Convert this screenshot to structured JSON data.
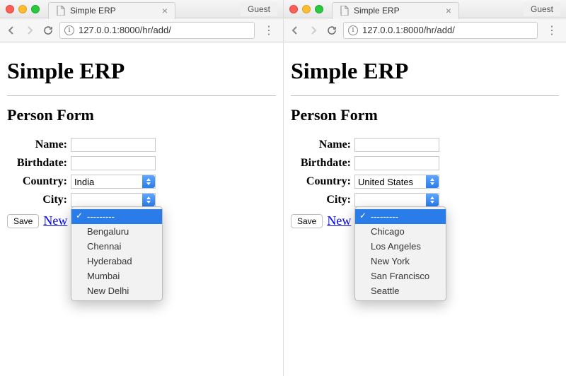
{
  "panes": [
    {
      "tab_title": "Simple ERP",
      "guest_label": "Guest",
      "url": "127.0.0.1:8000/hr/add/",
      "heading": "Simple ERP",
      "subheading": "Person Form",
      "labels": {
        "name": "Name:",
        "birthdate": "Birthdate:",
        "country": "Country:",
        "city": "City:"
      },
      "country_value": "India",
      "city_value": "",
      "save_label": "Save",
      "new_link_text": "New",
      "dropdown_items": [
        "---------",
        "Bengaluru",
        "Chennai",
        "Hyderabad",
        "Mumbai",
        "New Delhi"
      ],
      "dropdown_selected_index": 0
    },
    {
      "tab_title": "Simple ERP",
      "guest_label": "Guest",
      "url": "127.0.0.1:8000/hr/add/",
      "heading": "Simple ERP",
      "subheading": "Person Form",
      "labels": {
        "name": "Name:",
        "birthdate": "Birthdate:",
        "country": "Country:",
        "city": "City:"
      },
      "country_value": "United States",
      "city_value": "",
      "save_label": "Save",
      "new_link_text": "New",
      "dropdown_items": [
        "---------",
        "Chicago",
        "Los Angeles",
        "New York",
        "San Francisco",
        "Seattle"
      ],
      "dropdown_selected_index": 0
    }
  ]
}
